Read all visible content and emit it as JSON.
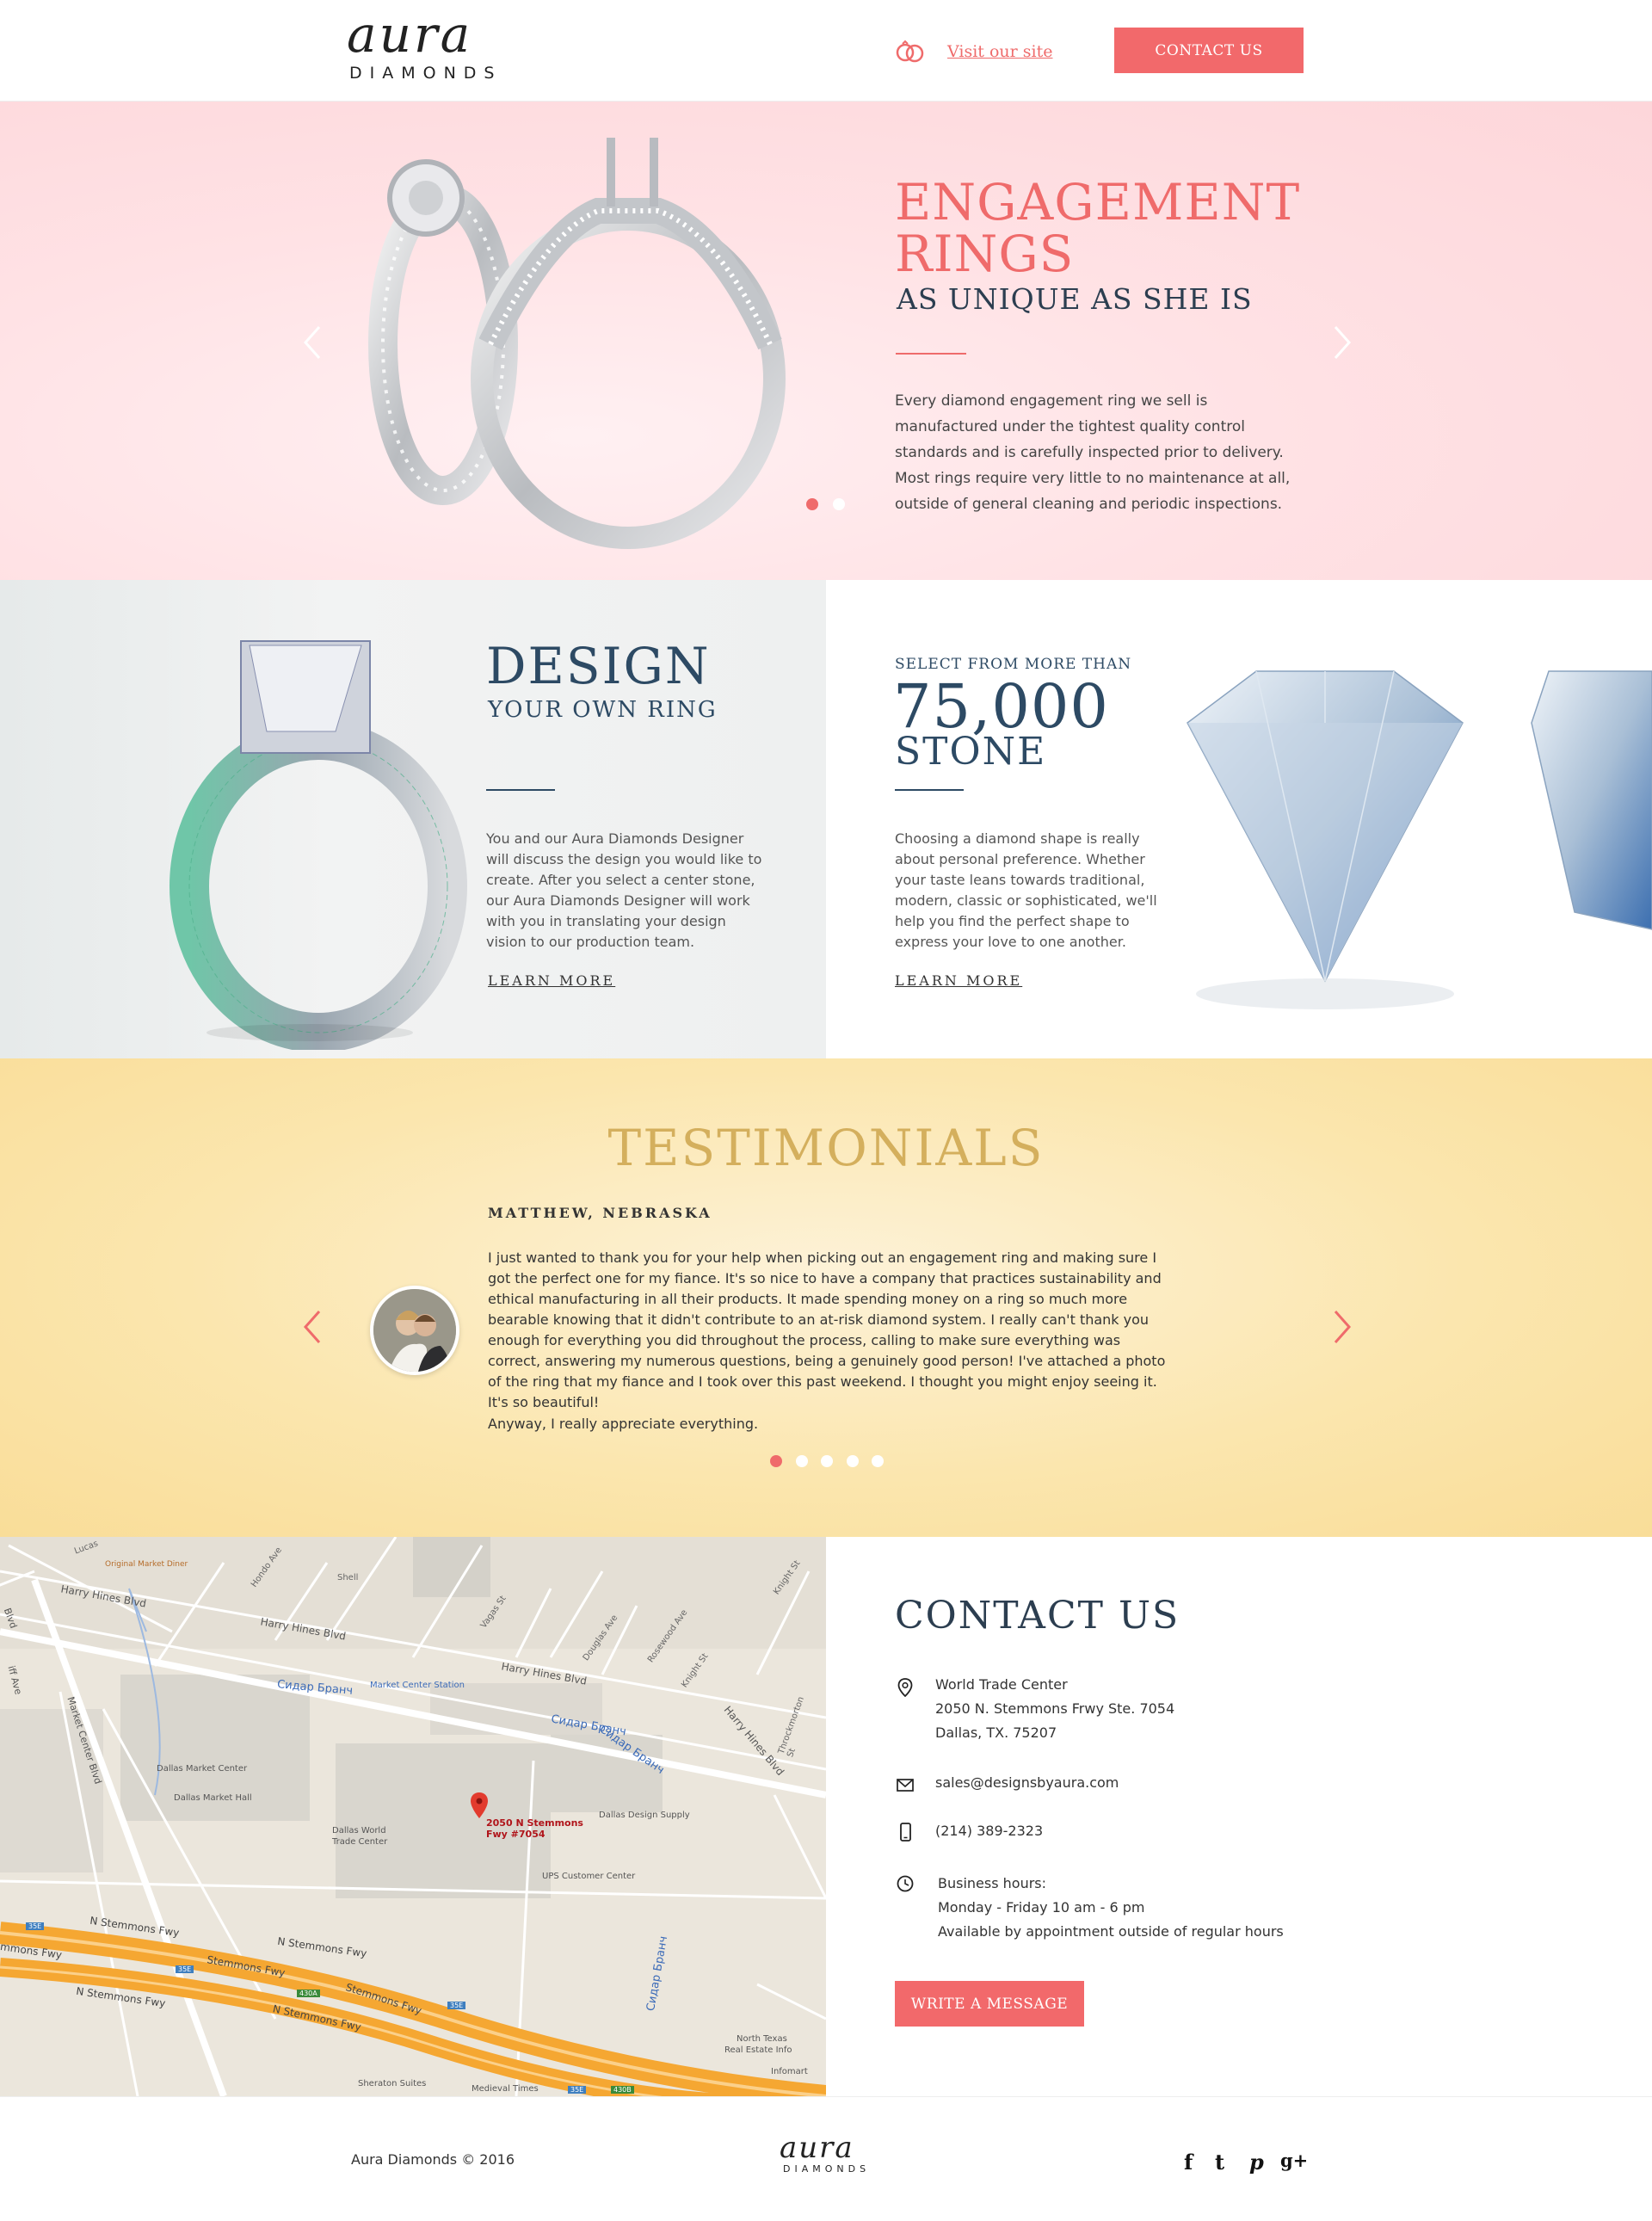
{
  "header": {
    "logo_main": "aura",
    "logo_sub": "DIAMONDS",
    "visit_link": "Visit our site",
    "contact_button": "CONTACT US"
  },
  "hero": {
    "title_line1": "ENGAGEMENT",
    "title_line2": "RINGS",
    "subtitle": "AS UNIQUE AS SHE IS",
    "text": "Every diamond engagement ring we sell is manufactured under the tightest quality control standards and is carefully inspected prior to delivery. Most rings require very little to no maintenance at all, outside of general cleaning and periodic inspections.",
    "slides_total": 2,
    "active_slide": 1
  },
  "design": {
    "title": "DESIGN",
    "subtitle": "YOUR OWN RING",
    "text": "You and our Aura Diamonds Designer will discuss the design you would like to create. After you select a center stone, our Aura Diamonds Designer will work with you in translating your design vision to our production team.",
    "link": "LEARN MORE"
  },
  "stone": {
    "kicker": "SELECT FROM MORE THAN",
    "number": "75,000",
    "label": "STONE",
    "text": "Choosing a diamond shape is really about personal preference.  Whether your taste leans towards traditional, modern, classic or sophisticated, we'll help you find the perfect shape to express your love to one another.",
    "link": "LEARN MORE"
  },
  "testimonials": {
    "title": "TESTIMONIALS",
    "name": "MATTHEW, NEBRASKA",
    "text": "I just wanted to thank you for your help when picking out an engagement ring and making sure I got the perfect one for my fiance. It's so nice to have a company that practices sustainability and ethical manufacturing in all their products. It made spending money on a ring so much more bearable knowing that it didn't contribute to an at-risk diamond system. I really can't thank you enough for everything you did throughout the process, calling to make sure everything was correct, answering my numerous questions, being a genuinely good person! I've attached a photo of the ring that my fiance and I took over this past weekend. I thought you might enjoy seeing it. It's so beautiful!",
    "text2": "Anyway, I really appreciate everything.",
    "slides_total": 5,
    "active_slide": 1
  },
  "map": {
    "pin_label_line1": "2050 N Stemmons",
    "pin_label_line2": "Fwy #7054",
    "labels": {
      "lucas": "Lucas",
      "original_market_diner": "Original Market Diner",
      "harry_hines_1": "Harry Hines Blvd",
      "harry_hines_2": "Harry Hines Blvd",
      "harry_hines_3": "Harry Hines Blvd",
      "harry_hines_4": "Harry Hines Blvd",
      "shell": "Shell",
      "hondo": "Hondo Ave",
      "vagas": "Vagas St",
      "douglas": "Douglas Ave",
      "rosewood": "Rosewood Ave",
      "knight": "Knight St",
      "knight2": "Knight St",
      "throckmorton": "Throckmorton St",
      "cidar1": "Сидар Бранч",
      "cidar2": "Сидар Бранч",
      "cidar3": "Сидар Бранч",
      "cidar4": "Сидар Бранч",
      "market_center_station": "Market Center Station",
      "market_center_blvd": "Market Center Blvd",
      "dallas_market_center": "Dallas Market Center",
      "dallas_market_hall": "Dallas Market Hall",
      "dallas_world_trade": "Dallas World",
      "dallas_world_trade2": "Trade Center",
      "dallas_design_supply": "Dallas Design Supply",
      "ups": "UPS Customer Center",
      "stemmons1": "N Stemmons Fwy",
      "stemmons2": "N Stemmons Fwy",
      "stemmons3": "Stemmons Fwy",
      "stemmons4": "N Stemmons Fwy",
      "stemmons5": "N Stemmons Fwy",
      "stemmons6": "Stemmons Fwy",
      "stemmons_left": "mmons Fwy",
      "north_texas": "North Texas",
      "north_texas2": "Real Estate Info",
      "infomart": "Infomart",
      "sheraton": "Sheraton Suites",
      "medieval": "Medieval Times",
      "iff": "iff Ave",
      "hwy35e_1": "35E",
      "hwy35e_2": "35E",
      "hwy35e_3": "35E",
      "hwy35e_4": "35E",
      "hwy430a": "430A",
      "hwy430b": "430B",
      "hines_blvd_left": "Blvd"
    }
  },
  "contact": {
    "title": "CONTACT US",
    "address1": "World Trade Center",
    "address2": "2050 N. Stemmons Frwy Ste. 7054",
    "address3": "Dallas, TX. 75207",
    "email": "sales@designsbyaura.com",
    "phone": "(214) 389-2323",
    "hours_label": "Business hours:",
    "hours1": "Monday - Friday 10 am - 6 pm",
    "hours2": "Available by appointment outside of regular hours",
    "button": "WRITE A MESSAGE"
  },
  "footer": {
    "copyright": "Aura Diamonds © 2016",
    "logo_main": "aura",
    "logo_sub": "DIAMONDS",
    "social": [
      "f",
      "t",
      "p",
      "g+"
    ]
  },
  "colors": {
    "accent": "#f2696b",
    "navy": "#2c3e50",
    "gold": "#d4af5d",
    "hero_bg": "#ffe2e5",
    "testimonial_bg": "#fbe6ae"
  }
}
